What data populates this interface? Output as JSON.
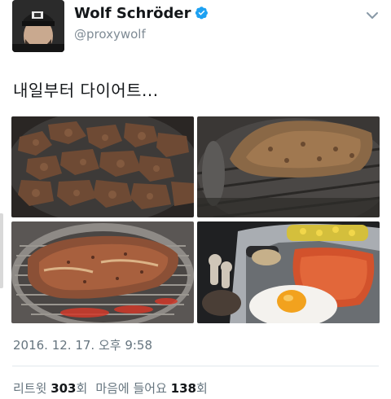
{
  "user": {
    "display_name": "Wolf Schröder",
    "handle": "@proxywolf"
  },
  "tweet": {
    "text": "내일부터 다이어트...",
    "timestamp": "2016. 12. 17. 오후 9:58"
  },
  "stats": {
    "retweet_label": "리트윗",
    "retweet_count": "303",
    "retweet_suffix": "회",
    "like_label": "마음에 들어요",
    "like_count": "138",
    "like_suffix": "회"
  },
  "photos": [
    {
      "icon": "grilled-meat-pieces-photo"
    },
    {
      "icon": "grilled-pork-slab-photo"
    },
    {
      "icon": "pork-on-grill-photo"
    },
    {
      "icon": "side-dishes-egg-photo"
    }
  ],
  "colors": {
    "verified": "#1da1f2",
    "secondary_text": "#66757f",
    "handle_text": "#7f8b95"
  }
}
